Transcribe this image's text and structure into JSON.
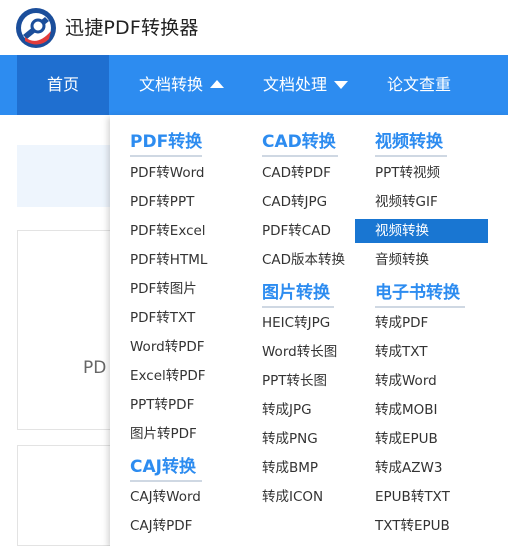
{
  "app": {
    "title": "迅捷PDF转换器"
  },
  "nav": {
    "home": "首页",
    "convert": "文档转换",
    "process": "文档处理",
    "paper": "论文查重"
  },
  "background": {
    "card_text": "PD"
  },
  "menu": {
    "pdf": {
      "title": "PDF转换",
      "items": [
        "PDF转Word",
        "PDF转PPT",
        "PDF转Excel",
        "PDF转HTML",
        "PDF转图片",
        "PDF转TXT",
        "Word转PDF",
        "Excel转PDF",
        "PPT转PDF",
        "图片转PDF"
      ]
    },
    "caj": {
      "title": "CAJ转换",
      "items": [
        "CAJ转Word",
        "CAJ转PDF"
      ]
    },
    "cad": {
      "title": "CAD转换",
      "items": [
        "CAD转PDF",
        "CAD转JPG",
        "PDF转CAD",
        "CAD版本转换"
      ]
    },
    "image": {
      "title": "图片转换",
      "items": [
        "HEIC转JPG",
        "Word转长图",
        "PPT转长图",
        "转成JPG",
        "转成PNG",
        "转成BMP",
        "转成ICON"
      ]
    },
    "video": {
      "title": "视频转换",
      "items": [
        "PPT转视频",
        "视频转GIF",
        "视频转换",
        "音频转换"
      ],
      "active_index": 2
    },
    "ebook": {
      "title": "电子书转换",
      "items": [
        "转成PDF",
        "转成TXT",
        "转成Word",
        "转成MOBI",
        "转成EPUB",
        "转成AZW3",
        "EPUB转TXT",
        "TXT转EPUB"
      ]
    }
  },
  "colors": {
    "nav_bg": "#2d8cf0",
    "nav_active_bg": "#1f6fd0",
    "category_title": "#2d8cf0",
    "active_item_bg": "#1976d2"
  },
  "icons": {
    "logo": "xunjie-pdf-logo",
    "convert_caret": "triangle-up-icon",
    "process_caret": "triangle-down-icon"
  }
}
